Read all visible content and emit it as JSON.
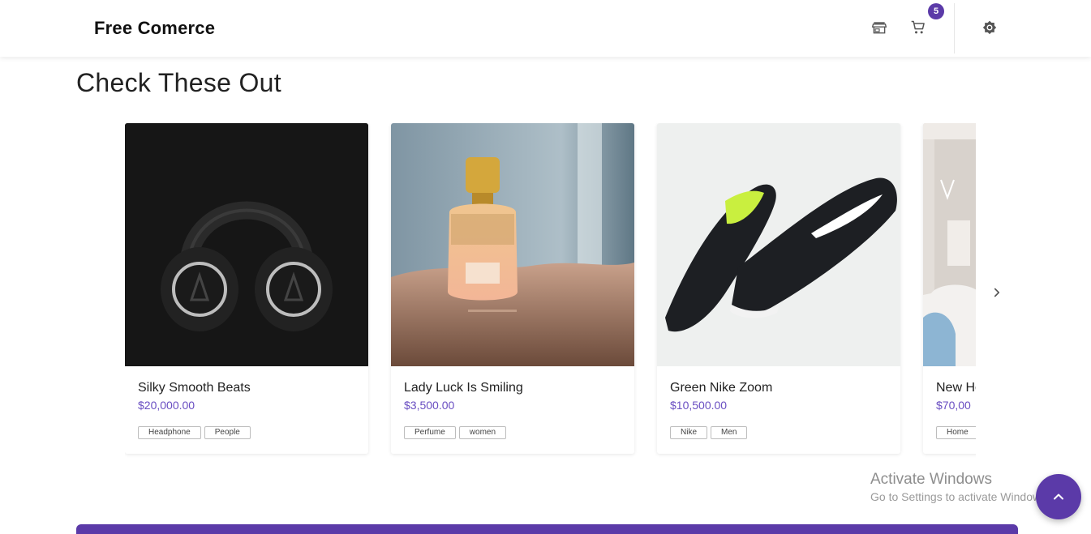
{
  "header": {
    "brand": "Free Comerce",
    "cart_count": "5",
    "icons": {
      "store": "store-icon",
      "cart": "cart-icon",
      "theme": "brightness-icon"
    }
  },
  "section": {
    "title": "Check These Out"
  },
  "products": [
    {
      "title": "Silky Smooth Beats",
      "price": "$20,000.00",
      "tags": [
        "Headphone",
        "People"
      ]
    },
    {
      "title": "Lady Luck Is Smiling",
      "price": "$3,500.00",
      "tags": [
        "Perfume",
        "women"
      ]
    },
    {
      "title": "Green Nike Zoom",
      "price": "$10,500.00",
      "tags": [
        "Nike",
        "Men"
      ]
    },
    {
      "title": "New Ho",
      "price": "$70,00",
      "tags": [
        "Home"
      ]
    }
  ],
  "carousel": {
    "next_icon": "chevron-right-icon"
  },
  "watermark": {
    "title": "Activate Windows",
    "subtitle": "Go to Settings to activate Windows."
  },
  "fab": {
    "icon": "chevron-up-icon"
  },
  "colors": {
    "accent": "#5b3aa8",
    "price": "#6a4fc2"
  }
}
